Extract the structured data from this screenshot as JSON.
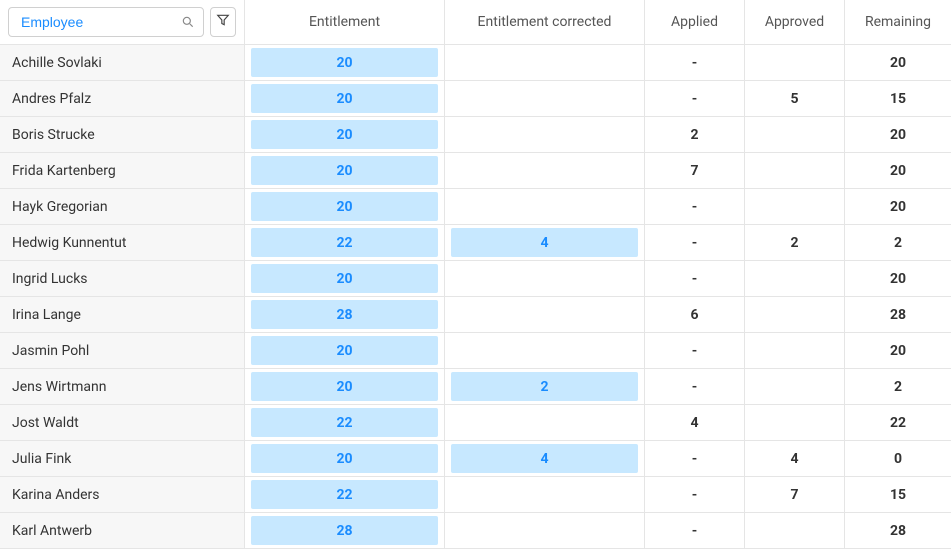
{
  "header": {
    "search_placeholder": "Employee",
    "columns": {
      "entitlement": "Entitlement",
      "entitlement_corrected": "Entitlement corrected",
      "applied": "Applied",
      "approved": "Approved",
      "remaining": "Remaining"
    }
  },
  "rows": [
    {
      "name": "Achille Sovlaki",
      "entitlement": "20",
      "entitlement_corrected": "",
      "applied": "-",
      "approved": "",
      "remaining": "20"
    },
    {
      "name": "Andres Pfalz",
      "entitlement": "20",
      "entitlement_corrected": "",
      "applied": "-",
      "approved": "5",
      "remaining": "15"
    },
    {
      "name": "Boris Strucke",
      "entitlement": "20",
      "entitlement_corrected": "",
      "applied": "2",
      "approved": "",
      "remaining": "20"
    },
    {
      "name": "Frida Kartenberg",
      "entitlement": "20",
      "entitlement_corrected": "",
      "applied": "7",
      "approved": "",
      "remaining": "20"
    },
    {
      "name": "Hayk Gregorian",
      "entitlement": "20",
      "entitlement_corrected": "",
      "applied": "-",
      "approved": "",
      "remaining": "20"
    },
    {
      "name": "Hedwig Kunnentut",
      "entitlement": "22",
      "entitlement_corrected": "4",
      "applied": "-",
      "approved": "2",
      "remaining": "2"
    },
    {
      "name": "Ingrid Lucks",
      "entitlement": "20",
      "entitlement_corrected": "",
      "applied": "-",
      "approved": "",
      "remaining": "20"
    },
    {
      "name": "Irina Lange",
      "entitlement": "28",
      "entitlement_corrected": "",
      "applied": "6",
      "approved": "",
      "remaining": "28"
    },
    {
      "name": "Jasmin Pohl",
      "entitlement": "20",
      "entitlement_corrected": "",
      "applied": "-",
      "approved": "",
      "remaining": "20"
    },
    {
      "name": "Jens Wirtmann",
      "entitlement": "20",
      "entitlement_corrected": "2",
      "applied": "-",
      "approved": "",
      "remaining": "2"
    },
    {
      "name": "Jost Waldt",
      "entitlement": "22",
      "entitlement_corrected": "",
      "applied": "4",
      "approved": "",
      "remaining": "22"
    },
    {
      "name": "Julia Fink",
      "entitlement": "20",
      "entitlement_corrected": "4",
      "applied": "-",
      "approved": "4",
      "remaining": "0"
    },
    {
      "name": "Karina Anders",
      "entitlement": "22",
      "entitlement_corrected": "",
      "applied": "-",
      "approved": "7",
      "remaining": "15"
    },
    {
      "name": "Karl Antwerb",
      "entitlement": "28",
      "entitlement_corrected": "",
      "applied": "-",
      "approved": "",
      "remaining": "28"
    }
  ]
}
